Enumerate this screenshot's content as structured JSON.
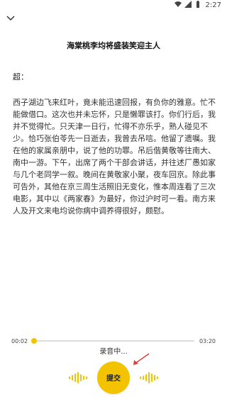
{
  "status_bar": {
    "time": "2:27",
    "icons": [
      "wifi-icon",
      "signal-icon",
      "battery-icon"
    ]
  },
  "header": {
    "collapse_icon": "chevron-down-icon"
  },
  "article": {
    "title": "海棠桃李均将盛装笑迎主人",
    "salutation": "超：",
    "body": "西子湖边飞来红叶，竟未能迅速回报，有负你的雅意。忙不能做借口。这次也并未忘怀，只是懒罪该打。你们行后，我并不觉得忙。只天津一日行，忙得不亦乐乎，熟人碰见不少。恰巧张伯苓先一日逝去，我曾去吊唁。他留了遗嘱。我在他的家属亲朋中，说了他的功罪。吊后偕黄敬等往南大、南中一游。下午，出席了两个干部会讲话，并往述厂愚如家与几个老同学一叙。晚间在黄敬家小聚，夜车回京。除此事可告外，其他在京三周生活照旧无变化，惟本周连看了三次电影，其中以《两家春》为最好，你过沪时可一看。南方来人及开文来电均说你病中调养得很好，颇慰。"
  },
  "player": {
    "current_time": "00:02",
    "total_time": "03:20",
    "progress": 0.01
  },
  "recording": {
    "status": "录音中...",
    "submit_label": "提交"
  },
  "colors": {
    "accent": "#f3c300",
    "arrow": "#e53935"
  }
}
